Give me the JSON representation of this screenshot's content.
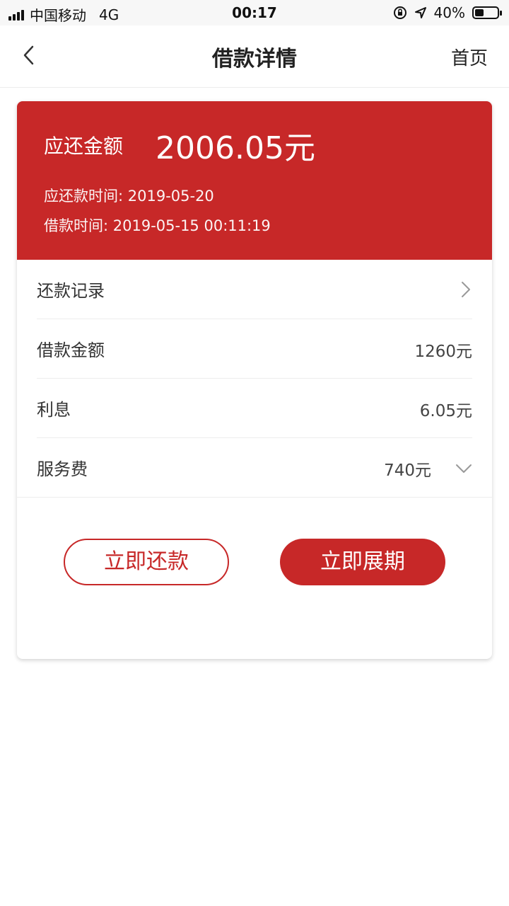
{
  "status_bar": {
    "carrier": "中国移动",
    "network": "4G",
    "time": "00:17",
    "battery": "40%",
    "battery_level": 0.4
  },
  "nav": {
    "title": "借款详情",
    "home_label": "首页"
  },
  "summary": {
    "amount_label": "应还金额",
    "amount_value": "2006.05元",
    "due_text": "应还款时间: 2019-05-20",
    "loan_time_text": "借款时间: 2019-05-15 00:11:19"
  },
  "rows": [
    {
      "label": "还款记录",
      "value": ""
    },
    {
      "label": "借款金额",
      "value": "1260元"
    },
    {
      "label": "利息",
      "value": "6.05元"
    },
    {
      "label": "服务费",
      "value": "740元"
    }
  ],
  "buttons": {
    "repay_label": "立即还款",
    "extend_label": "立即展期"
  },
  "colors": {
    "accent": "#c72828"
  }
}
